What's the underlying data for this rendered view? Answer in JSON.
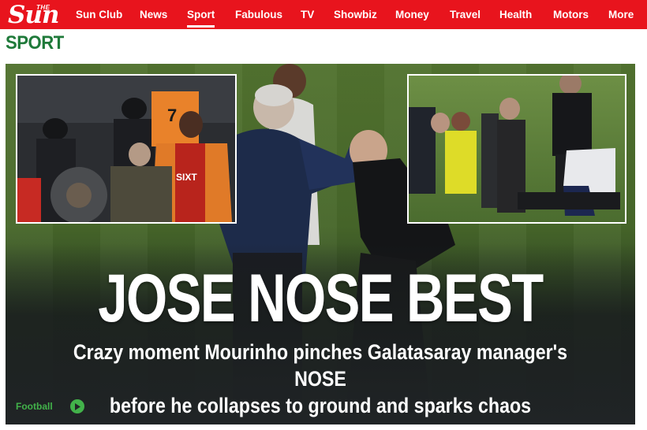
{
  "brand": {
    "logo_small": "THE",
    "logo_word": "Sun",
    "accent": "#e8141d",
    "sport_green": "#1f7a3a",
    "tag_green": "#42b24a"
  },
  "nav": {
    "items": [
      {
        "label": "Sun Club",
        "active": false
      },
      {
        "label": "News",
        "active": false
      },
      {
        "label": "Sport",
        "active": true
      },
      {
        "label": "Fabulous",
        "active": false
      },
      {
        "label": "TV",
        "active": false
      },
      {
        "label": "Showbiz",
        "active": false
      },
      {
        "label": "Money",
        "active": false
      },
      {
        "label": "Travel",
        "active": false
      },
      {
        "label": "Health",
        "active": false
      },
      {
        "label": "Motors",
        "active": false
      },
      {
        "label": "More",
        "active": false
      }
    ]
  },
  "section": {
    "title": "SPORT"
  },
  "hero": {
    "headline": "JOSE NOSE BEST",
    "standfirst_line1": "Crazy moment Mourinho pinches Galatasaray manager's NOSE",
    "standfirst_line2": "before he collapses to ground and sparks chaos",
    "tag": "Football",
    "tag_icon": "play-icon",
    "inset_left_shirt_text": "SIXT",
    "inset_left_shirt_number": "7"
  }
}
